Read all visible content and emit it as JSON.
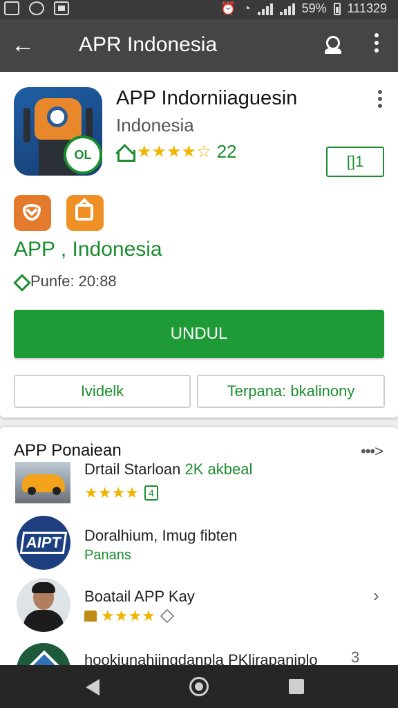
{
  "status_bar": {
    "battery": "59%",
    "time": "111329"
  },
  "toolbar": {
    "title": "APR Indonesia"
  },
  "app": {
    "name": "APP Indorniiaguesin",
    "developer": "Indonesia",
    "rating_stars": "★★★★☆",
    "rating_count": "22",
    "install_small_label": "[]1",
    "subtitle": "APP , Indonesia",
    "meta_label": "Punfe:",
    "meta_value": "20:88",
    "primary_button": "UNDUL",
    "secondary_left": "Ividelk",
    "secondary_right": "Terpana: bkalinony",
    "icon_badge_text": "OL"
  },
  "related": {
    "title": "APP Ponaiean",
    "more_label": "•••>",
    "items": [
      {
        "title": "Drtail Starloan",
        "title_accent": "2K akbeal",
        "stars": "★★★★",
        "tag": "4"
      },
      {
        "title": "Doralhium, Imug fibten",
        "subtitle": "Panans",
        "logo_text": "AIPT"
      },
      {
        "title": "Boatail APP Kay",
        "stars": "★★★★"
      },
      {
        "title": "hookiunahiingdanpla PKlirapaniplo",
        "trailing": "3"
      }
    ]
  },
  "colors": {
    "accent_green": "#1e9a37",
    "toolbar": "#454545",
    "star": "#f1b400",
    "badge_orange": "#e98a26"
  }
}
